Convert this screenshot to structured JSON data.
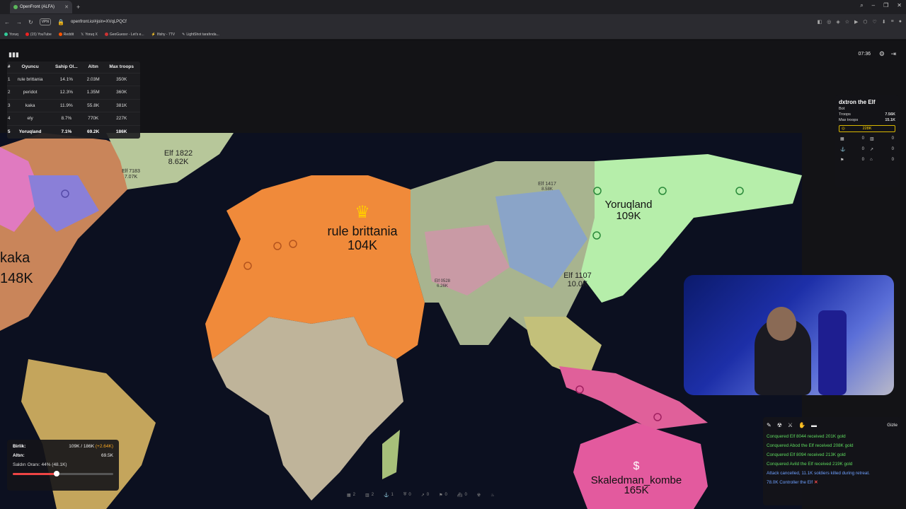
{
  "browser": {
    "tab_title": "OpenFront (ALFA)",
    "url": "openfront.io/#join=XVqLPQCf",
    "vpn": "VPN",
    "bookmarks": [
      "Yoruq",
      "(15) YouTube",
      "Reddit",
      "Yoruq X",
      "GeoGuessr - Let's e...",
      "Ifishy - 7TV",
      "LightShot tarafında..."
    ]
  },
  "leaderboard": {
    "headers": [
      "#",
      "Oyuncu",
      "Sahip Ol...",
      "Altın",
      "Max troops"
    ],
    "rows": [
      {
        "rank": "1",
        "name": "rule brittania",
        "owned": "14.1%",
        "gold": "2.03M",
        "max": "350K"
      },
      {
        "rank": "2",
        "name": "peridot",
        "owned": "12.3%",
        "gold": "1.35M",
        "max": "360K"
      },
      {
        "rank": "3",
        "name": "kaka",
        "owned": "11.9%",
        "gold": "55.8K",
        "max": "381K"
      },
      {
        "rank": "4",
        "name": "ely",
        "owned": "8.7%",
        "gold": "770K",
        "max": "227K"
      },
      {
        "rank": "5",
        "name": "Yoruqland",
        "owned": "7.1%",
        "gold": "69.2K",
        "max": "186K"
      }
    ]
  },
  "clock": "07:36",
  "player_panel": {
    "name": "dxtron the Elf",
    "type": "Bot",
    "troops_label": "Troops",
    "troops": "7.56K",
    "max_troops_label": "Max troops",
    "max_troops": "15.1K",
    "gold": "228K",
    "buildings": [
      "0",
      "0",
      "0",
      "0",
      "0",
      "0"
    ]
  },
  "map": {
    "players": [
      {
        "name": "rule brittania",
        "troops": "104K"
      },
      {
        "name": "Yoruqland",
        "troops": "109K"
      },
      {
        "name": "kaka",
        "troops": "148K"
      },
      {
        "name": "Skaledman_kombe",
        "troops": "165K"
      },
      {
        "name": "Elf 1822",
        "troops": "8.62K"
      },
      {
        "name": "Elf 7183",
        "troops": "7.07K"
      },
      {
        "name": "Elf 1107",
        "troops": "10.0K"
      },
      {
        "name": "Elf 1417",
        "troops": "8.58K"
      },
      {
        "name": "Elf 0528",
        "troops": "6.26K"
      }
    ]
  },
  "stats": {
    "units_label": "Birlik:",
    "units_value": "109K / 186K",
    "units_gain": "(+2.64K)",
    "gold_label": "Altın:",
    "gold_value": "69.5K",
    "attack_label": "Saldırı Oranı: 44% (48.1K)",
    "attack_ratio": 0.44
  },
  "buildbar": [
    "2",
    "2",
    "1",
    "0",
    "0",
    "0",
    "0"
  ],
  "events": {
    "hide_label": "Gizle",
    "items": [
      {
        "text": "Conquered Elf 8044 received 201K gold",
        "color": "green"
      },
      {
        "text": "Conquered Abod the Elf received 208K gold",
        "color": "green"
      },
      {
        "text": "Conquered Elf 8094 received 213K gold",
        "color": "green"
      },
      {
        "text": "Conquered Avild the Elf received 219K gold",
        "color": "green"
      },
      {
        "text": "Attack cancelled, 11.1K soldiers killed during retreat.",
        "color": "blue"
      },
      {
        "text": "78.0K Controller the Elf",
        "color": "blue"
      }
    ]
  }
}
